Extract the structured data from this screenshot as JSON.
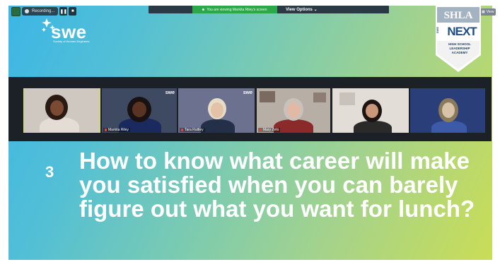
{
  "zoom_controls": {
    "recording_label": "Recording...",
    "pause_symbol": "❚❚",
    "stop_symbol": "■",
    "viewing_text": "You are viewing Markita Riley's screen",
    "view_options_label": "View Options",
    "view_button_label": "View"
  },
  "slide": {
    "brand": {
      "name": "swe",
      "tagline": "Society of Women Engineers"
    },
    "badge": {
      "top": "SHLA",
      "main": "NEXT",
      "side": "SWE",
      "lines": [
        "HIGH SCHOOL",
        "LEADERSHIP",
        "ACADEMY"
      ]
    },
    "question_number": "3",
    "question_text": "How to know what career will make you satisfied when you can barely figure out what you want for lunch?"
  },
  "participants": [
    {
      "name": "",
      "active_speaker": true
    },
    {
      "name": "Markita Riley",
      "overlay": "swe"
    },
    {
      "name": "Tara Ruttley",
      "overlay": "swe"
    },
    {
      "name": "Mary Zelo"
    },
    {
      "name": ""
    },
    {
      "name": ""
    }
  ],
  "colors": {
    "gradient_start": "#3cb6e6",
    "gradient_end": "#c9dd56",
    "gallery_bg": "#1c2128",
    "active_speaker_border": "#d4e640",
    "viewing_green": "#2aa84a"
  }
}
